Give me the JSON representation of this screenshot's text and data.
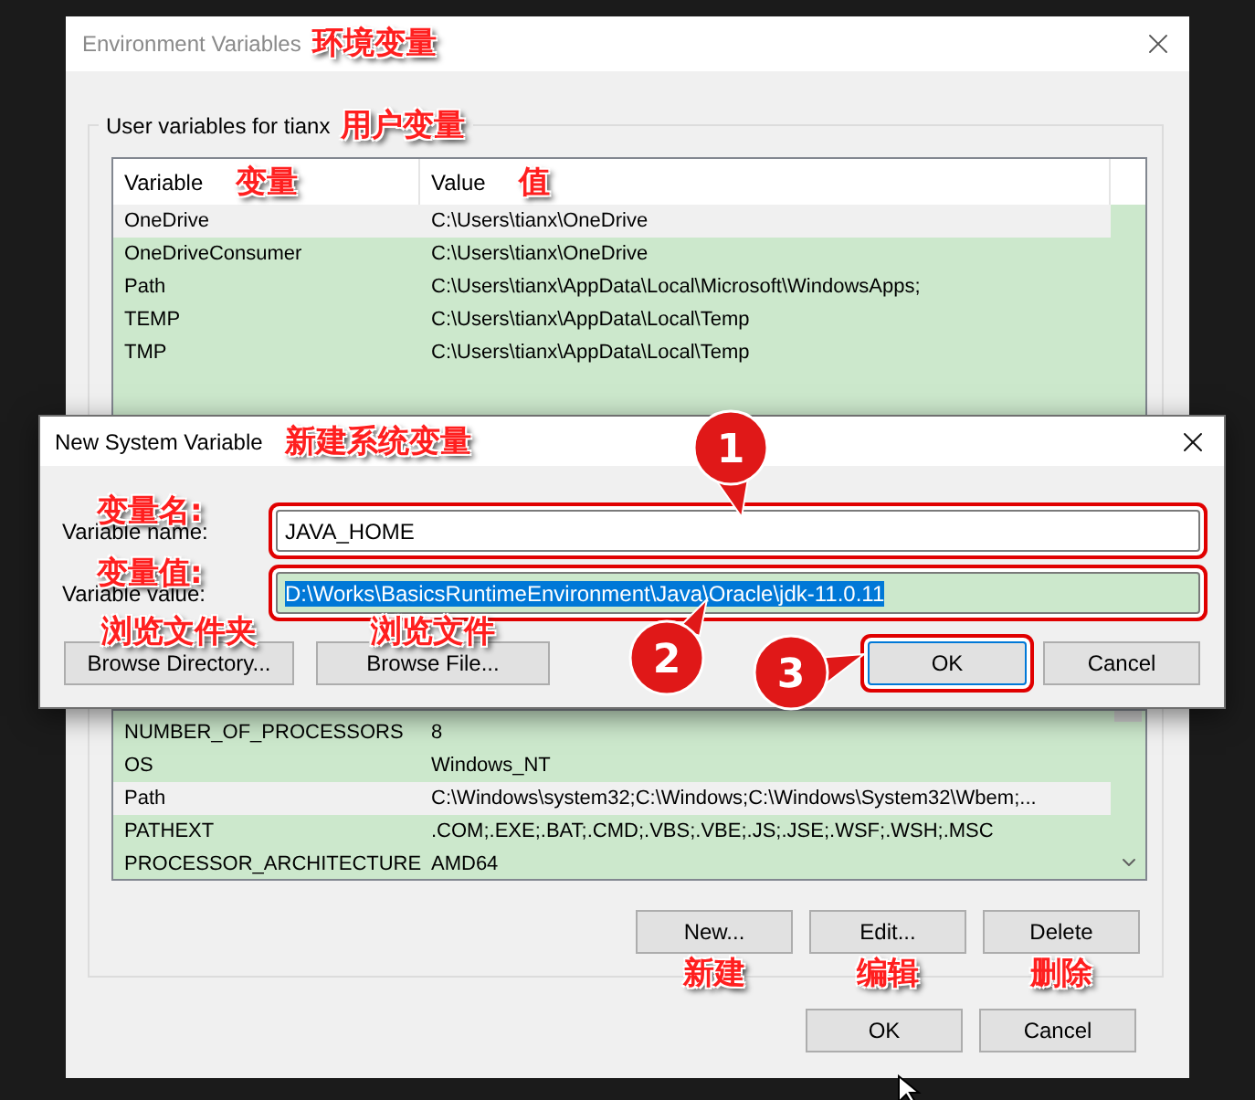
{
  "window": {
    "title": "Environment Variables",
    "title_note": "环境变量"
  },
  "user_variables": {
    "legend": "User variables for tianx",
    "legend_note": "用户变量",
    "columns": [
      {
        "label": "Variable",
        "note": "变量"
      },
      {
        "label": "Value",
        "note": "值"
      }
    ],
    "rows": [
      {
        "variable": "OneDrive",
        "value": "C:\\Users\\tianx\\OneDrive",
        "selected": true
      },
      {
        "variable": "OneDriveConsumer",
        "value": "C:\\Users\\tianx\\OneDrive",
        "selected": false
      },
      {
        "variable": "Path",
        "value": "C:\\Users\\tianx\\AppData\\Local\\Microsoft\\WindowsApps;",
        "selected": false
      },
      {
        "variable": "TEMP",
        "value": "C:\\Users\\tianx\\AppData\\Local\\Temp",
        "selected": false
      },
      {
        "variable": "TMP",
        "value": "C:\\Users\\tianx\\AppData\\Local\\Temp",
        "selected": false
      }
    ]
  },
  "system_variables": {
    "rows": [
      {
        "variable": "NUMBER_OF_PROCESSORS",
        "value": "8",
        "selected": false
      },
      {
        "variable": "OS",
        "value": "Windows_NT",
        "selected": false
      },
      {
        "variable": "Path",
        "value": "C:\\Windows\\system32;C:\\Windows;C:\\Windows\\System32\\Wbem;...",
        "selected": true
      },
      {
        "variable": "PATHEXT",
        "value": ".COM;.EXE;.BAT;.CMD;.VBS;.VBE;.JS;.JSE;.WSF;.WSH;.MSC",
        "selected": false
      },
      {
        "variable": "PROCESSOR_ARCHITECTURE",
        "value": "AMD64",
        "selected": false
      }
    ],
    "buttons": [
      {
        "label": "New...",
        "note": "新建"
      },
      {
        "label": "Edit...",
        "note": "编辑"
      },
      {
        "label": "Delete",
        "note": "删除"
      }
    ]
  },
  "buttons": [
    "OK",
    "Cancel"
  ],
  "dialog": {
    "title": "New System Variable",
    "title_note": "新建系统变量",
    "fields": [
      {
        "label": "Variable name:",
        "note": "变量名:",
        "value": "JAVA_HOME",
        "text_selected": false,
        "highlighted": true
      },
      {
        "label": "Variable value:",
        "note": "变量值:",
        "value": "D:\\Works\\BasicsRuntimeEnvironment\\Java\\Oracle\\jdk-11.0.11",
        "text_selected": true,
        "highlighted": true
      }
    ],
    "buttons": [
      {
        "label": "Browse Directory...",
        "note": "浏览文件夹",
        "highlighted": false,
        "focused": false
      },
      {
        "label": "Browse File...",
        "note": "浏览文件",
        "highlighted": false,
        "focused": false
      },
      {
        "label": "OK",
        "highlighted": true,
        "focused": true
      },
      {
        "label": "Cancel",
        "highlighted": false,
        "focused": false
      }
    ]
  },
  "callouts": [
    {
      "number": "1"
    },
    {
      "number": "2"
    },
    {
      "number": "3"
    }
  ]
}
